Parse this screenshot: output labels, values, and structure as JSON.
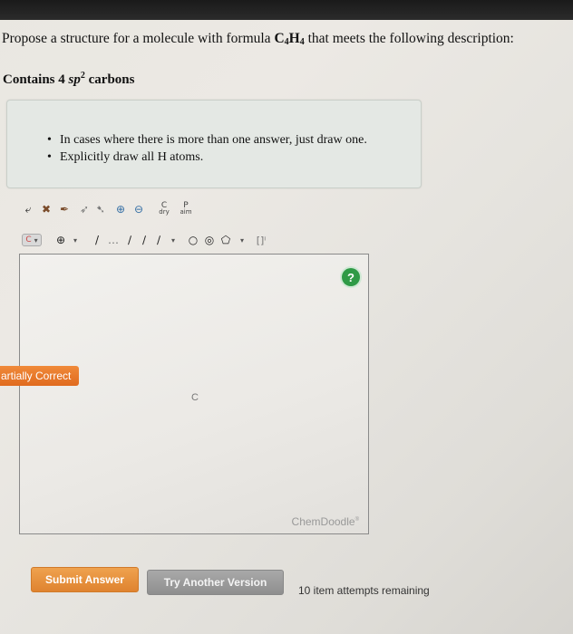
{
  "question": {
    "prefix": "Propose a structure for a molecule with formula ",
    "formula_c": "C",
    "formula_c_sub": "4",
    "formula_h": "H",
    "formula_h_sub": "4",
    "suffix": " that meets the following description:"
  },
  "condition": {
    "prefix": "Contains 4 ",
    "sp": "sp",
    "sup": "2",
    "suffix": " carbons"
  },
  "instructions": [
    "In cases where there is more than one answer, just draw one.",
    "Explicitly draw all H atoms."
  ],
  "toolbar": {
    "row1": [
      {
        "icon": "undo-icon",
        "glyph": "⤶"
      },
      {
        "icon": "clear-icon",
        "glyph": "✖"
      },
      {
        "icon": "eraser-icon",
        "glyph": "✒"
      },
      {
        "icon": "lasso-icon",
        "glyph": "➶"
      },
      {
        "icon": "select-icon",
        "glyph": "➷"
      },
      {
        "icon": "zoom-in-icon",
        "glyph": "⊕"
      },
      {
        "icon": "zoom-out-icon",
        "glyph": "⊖"
      }
    ],
    "cleanup_label": "C",
    "cleanup_sub": "dry",
    "perspective_label": "P",
    "perspective_sub": "aim",
    "atom_label": "C",
    "charge_label": "⊕",
    "bond_glyphs": [
      "/",
      "…",
      "∕",
      "∕",
      "∕"
    ],
    "ring_glyphs": [
      "○",
      "◎",
      "⬠"
    ],
    "bracket_label": "[]ⁱ"
  },
  "canvas": {
    "help_label": "?",
    "atom_label": "C",
    "watermark": "ChemDoodle",
    "watermark_mark": "®"
  },
  "status": {
    "partial_label": "artially Correct"
  },
  "actions": {
    "submit_label": "Submit Answer",
    "try_label": "Try Another Version",
    "remaining_text": "10 item attempts remaining"
  },
  "colors": {
    "submit": "#e8923f",
    "try": "#9c9c9c",
    "partial": "#e8782a",
    "help": "#2f9a46"
  }
}
